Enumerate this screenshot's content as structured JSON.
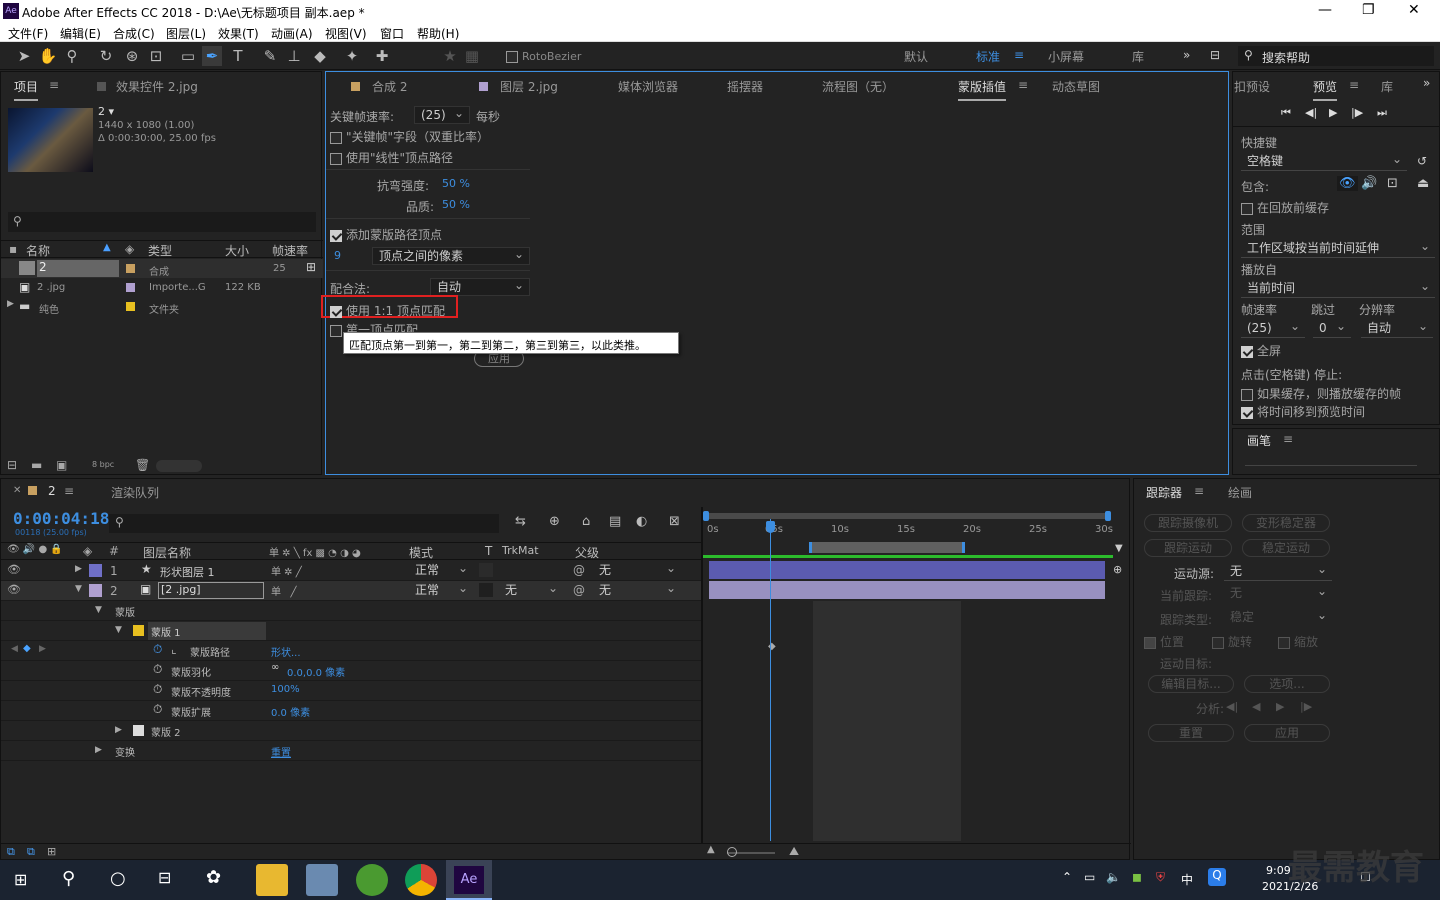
{
  "titlebar": {
    "title": "Adobe After Effects CC 2018 - D:\\Ae\\无标题项目 副本.aep *",
    "logo": "Ae",
    "min": "—",
    "max": "❐",
    "close": "✕"
  },
  "menu": [
    "文件(F)",
    "编辑(E)",
    "合成(C)",
    "图层(L)",
    "效果(T)",
    "动画(A)",
    "视图(V)",
    "窗口",
    "帮助(H)"
  ],
  "toolbar": {
    "rotobezier": "RotoBezier",
    "workspaces": [
      "默认",
      "标准",
      "小屏幕",
      "库"
    ],
    "more": "»",
    "search_placeholder": "搜索帮助",
    "active_ws": "标准"
  },
  "project": {
    "tab_project": "项目",
    "tab_effects": "效果控件 2.jpg",
    "comp_name": "2 ▾",
    "comp_res": "1440 x 1080 (1.00)",
    "comp_dur": "Δ 0:00:30:00, 25.00 fps",
    "search": "",
    "cols": {
      "name": "名称",
      "type": "类型",
      "size": "大小",
      "fps": "帧速率"
    },
    "items": [
      {
        "name": "2",
        "type": "合成",
        "size": "",
        "fps": "25",
        "color": "#c8a060"
      },
      {
        "name": "2 .jpg",
        "type": "Importe...G",
        "size": "122 KB",
        "fps": "",
        "color": "#b0a0d0"
      },
      {
        "name": "纯色",
        "type": "文件夹",
        "size": "",
        "fps": "",
        "color": "#e8c020"
      }
    ],
    "bpc": "8 bpc"
  },
  "center_tabs": [
    "合成 2",
    "图层 2.jpg",
    "媒体浏览器",
    "摇摆器",
    "流程图（无）",
    "蒙版插值",
    "动态草图"
  ],
  "mask_interp": {
    "kf_rate_label": "关键帧速率:",
    "kf_rate": "(25)",
    "per_sec": "每秒",
    "kf_field": "\"关键帧\"字段（双重比率）",
    "linear": "使用\"线性\"顶点路径",
    "bend_label": "抗弯强度:",
    "bend": "50 %",
    "quality_label": "品质:",
    "quality": "50 %",
    "add_vert": "添加蒙版路径顶点",
    "add_num": "9",
    "add_mode": "顶点之间的像素",
    "match_label": "配合法:",
    "match": "自动",
    "use11": "使用 1:1 顶点匹配",
    "first": "第一顶点匹配",
    "apply": "应用",
    "tooltip": "匹配顶点第一到第一，第二到第二，第三到第三，以此类推。"
  },
  "preview": {
    "tab_left": "扣预设",
    "tab": "预览",
    "tab_lib": "库",
    "shortcut_label": "快捷键",
    "shortcut": "空格键",
    "include": "包含:",
    "cache_before": "在回放前缓存",
    "range_label": "范围",
    "range": "工作区域按当前时间延伸",
    "play_from_label": "播放自",
    "play_from": "当前时间",
    "fr_label": "帧速率",
    "skip_label": "跳过",
    "res_label": "分辨率",
    "fr": "(25)",
    "skip": "0",
    "res": "自动",
    "fullscreen": "全屏",
    "stop_label": "点击(空格键) 停止:",
    "if_cached": "如果缓存，则播放缓存的帧",
    "move_time": "将时间移到预览时间",
    "brush": "画笔"
  },
  "timeline": {
    "comp_tab": "2",
    "render_queue": "渲染队列",
    "time": "0:00:04:18",
    "frames": "00118 (25.00 fps)",
    "cols": {
      "name": "图层名称",
      "mode": "模式",
      "t": "T",
      "trk": "TrkMat",
      "parent": "父级"
    },
    "ruler": [
      "0s",
      "05s",
      "10s",
      "15s",
      "20s",
      "25s",
      "30s"
    ],
    "layers": [
      {
        "num": "1",
        "name": "形状图层 1",
        "mode": "正常",
        "trk": "",
        "parent": "无",
        "color": "#7070c8"
      },
      {
        "num": "2",
        "name": "[2 .jpg]",
        "mode": "正常",
        "trk": "无",
        "parent": "无",
        "color": "#b0a0d0"
      }
    ],
    "props": {
      "masks": "蒙版",
      "mask1": "蒙版 1",
      "path": "蒙版路径",
      "path_val": "形状...",
      "feather": "蒙版羽化",
      "feather_val": "0.0,0.0 像素",
      "opacity": "蒙版不透明度",
      "opacity_val": "100%",
      "expansion": "蒙版扩展",
      "expansion_val": "0.0 像素",
      "mask2": "蒙版 2",
      "transform": "变换",
      "reset": "重置"
    }
  },
  "tracker": {
    "tab": "跟踪器",
    "tab2": "绘画",
    "track_camera": "跟踪摄像机",
    "warp": "变形稳定器",
    "track_motion": "跟踪运动",
    "stabilize": "稳定运动",
    "source_label": "运动源:",
    "source": "无",
    "current_label": "当前跟踪:",
    "current": "无",
    "type_label": "跟踪类型:",
    "type": "稳定",
    "pos": "位置",
    "rot": "旋转",
    "scale": "缩放",
    "target_label": "运动目标:",
    "edit_target": "编辑目标...",
    "options": "选项...",
    "analyze": "分析:",
    "reset": "重置",
    "apply": "应用"
  },
  "taskbar": {
    "time": "9:09",
    "date": "2021/2/26",
    "ime": "中",
    "watermark": "最需教育"
  }
}
